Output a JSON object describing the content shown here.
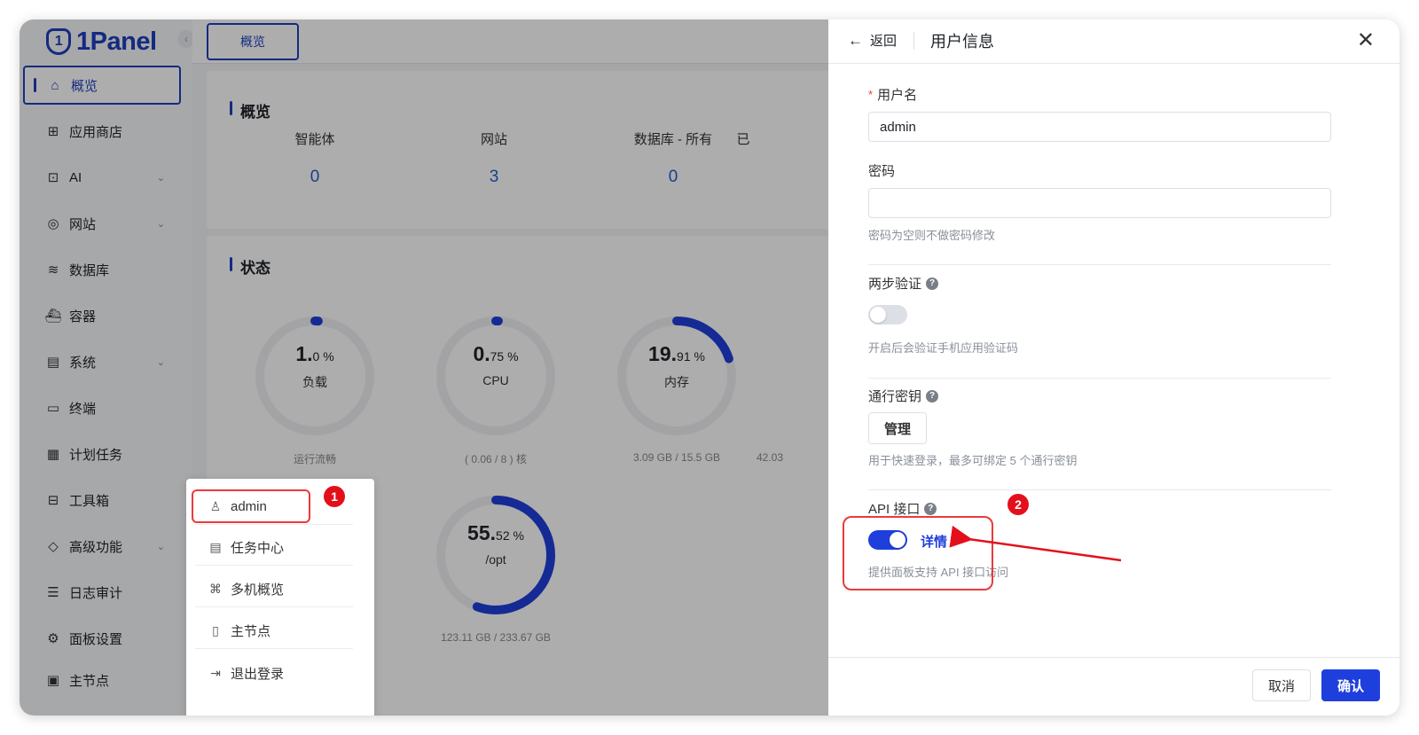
{
  "app": {
    "logo_text": "1Panel",
    "logo_mark": "1",
    "collapse_icon": "chevron-left-icon"
  },
  "sidebar": {
    "items": [
      {
        "label": "概览",
        "icon": "home-icon",
        "active": true,
        "expandable": false
      },
      {
        "label": "应用商店",
        "icon": "grid-icon",
        "active": false,
        "expandable": false
      },
      {
        "label": "AI",
        "icon": "robot-icon",
        "active": false,
        "expandable": true
      },
      {
        "label": "网站",
        "icon": "globe-icon",
        "active": false,
        "expandable": true
      },
      {
        "label": "数据库",
        "icon": "layers-icon",
        "active": false,
        "expandable": false
      },
      {
        "label": "容器",
        "icon": "docker-icon",
        "active": false,
        "expandable": false
      },
      {
        "label": "系统",
        "icon": "server-icon",
        "active": false,
        "expandable": true
      },
      {
        "label": "终端",
        "icon": "terminal-icon",
        "active": false,
        "expandable": false
      },
      {
        "label": "计划任务",
        "icon": "calendar-icon",
        "active": false,
        "expandable": false
      },
      {
        "label": "工具箱",
        "icon": "toolbox-icon",
        "active": false,
        "expandable": false
      },
      {
        "label": "高级功能",
        "icon": "diamond-icon",
        "active": false,
        "expandable": true
      },
      {
        "label": "日志审计",
        "icon": "log-icon",
        "active": false,
        "expandable": false
      },
      {
        "label": "面板设置",
        "icon": "gear-icon",
        "active": false,
        "expandable": false
      },
      {
        "label": "主节点",
        "icon": "node-icon",
        "active": false,
        "expandable": false
      }
    ]
  },
  "topbar": {
    "tab_label": "概览"
  },
  "overview": {
    "title": "概览",
    "items": [
      {
        "label": "智能体",
        "value": "0"
      },
      {
        "label": "网站",
        "value": "3"
      },
      {
        "label": "数据库 - 所有",
        "value": "0"
      },
      {
        "label": "已",
        "value": ""
      }
    ]
  },
  "status": {
    "title": "状态",
    "gauges": [
      {
        "int": "1.",
        "dec": "0 %",
        "name": "负载",
        "sub": "运行流畅",
        "percent": 1.0
      },
      {
        "int": "0.",
        "dec": "75 %",
        "name": "CPU",
        "sub": "( 0.06 / 8 ) 核",
        "percent": 0.75
      },
      {
        "int": "19.",
        "dec": "91 %",
        "name": "内存",
        "sub": "3.09 GB / 15.5 GB",
        "percent": 19.91
      },
      {
        "int": "55.",
        "dec": "52 %",
        "name": "/opt",
        "sub": "123.11 GB / 233.67 GB",
        "percent": 55.52
      }
    ],
    "partial_sub": "42.03"
  },
  "user_menu": {
    "items": [
      {
        "label": "admin",
        "icon": "user-icon"
      },
      {
        "label": "任务中心",
        "icon": "task-icon"
      },
      {
        "label": "多机概览",
        "icon": "cluster-icon"
      },
      {
        "label": "主节点",
        "icon": "phone-icon"
      },
      {
        "label": "退出登录",
        "icon": "logout-icon"
      }
    ],
    "step_badge": "1"
  },
  "drawer": {
    "back_label": "返回",
    "title": "用户信息",
    "username_label": "用户名",
    "username_value": "admin",
    "password_label": "密码",
    "password_value": "",
    "password_hint": "密码为空则不做密码修改",
    "twofa_label": "两步验证",
    "twofa_enabled": false,
    "twofa_hint": "开启后会验证手机应用验证码",
    "passkey_label": "通行密钥",
    "passkey_button": "管理",
    "passkey_hint": "用于快速登录，最多可绑定 5 个通行密钥",
    "api_label": "API 接口",
    "api_enabled": true,
    "api_detail": "详情",
    "api_hint": "提供面板支持 API 接口访问",
    "step_badge": "2",
    "cancel_label": "取消",
    "confirm_label": "确认"
  },
  "colors": {
    "accent": "#1f3fdc",
    "brand": "#1f3fbf",
    "annotation": "#e93b3b",
    "badge": "#e3101b"
  }
}
